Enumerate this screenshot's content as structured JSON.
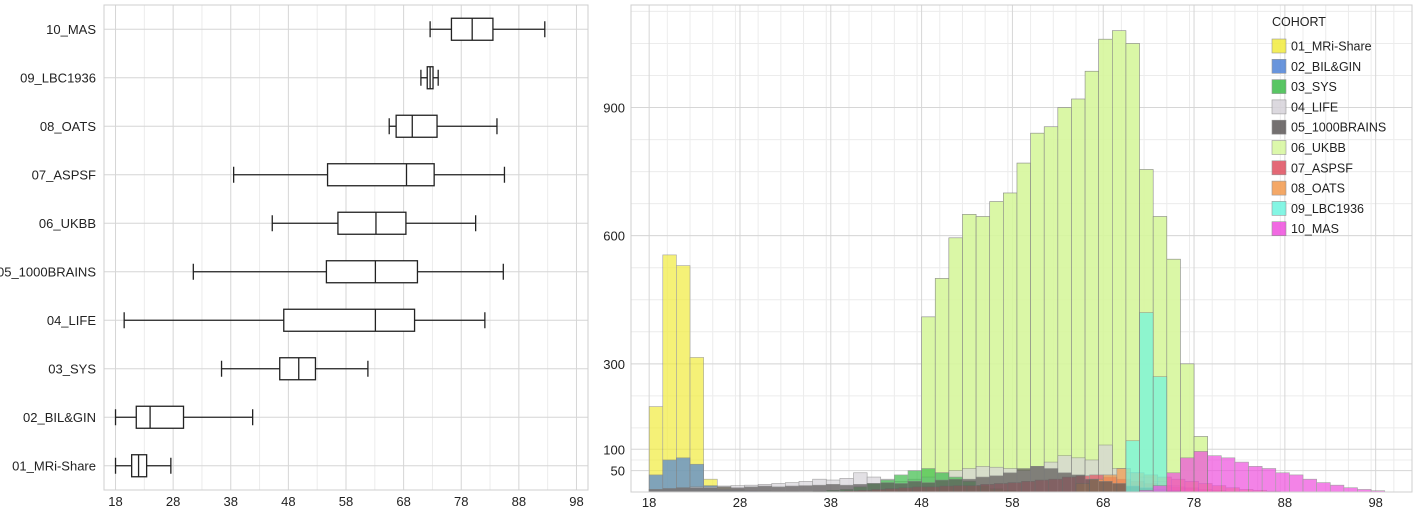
{
  "chart_data": [
    {
      "type": "boxplot",
      "orientation": "horizontal",
      "xlim": [
        16,
        100
      ],
      "xticks": [
        18,
        28,
        38,
        48,
        58,
        68,
        78,
        88,
        98
      ],
      "grid": true,
      "categories": [
        "10_MAS",
        "09_LBC1936",
        "08_OATS",
        "07_ASPSF",
        "06_UKBB",
        "05_1000BRAINS",
        "04_LIFE",
        "03_SYS",
        "02_BIL&GIN",
        "01_MRi-Share"
      ],
      "boxes": [
        {
          "name": "10_MAS",
          "min": 72.6,
          "q1": 76.3,
          "median": 79.9,
          "q3": 83.5,
          "max": 92.5
        },
        {
          "name": "09_LBC1936",
          "min": 71.0,
          "q1": 72.1,
          "median": 72.6,
          "q3": 73.1,
          "max": 74.0
        },
        {
          "name": "08_OATS",
          "min": 65.5,
          "q1": 66.7,
          "median": 69.5,
          "q3": 73.8,
          "max": 84.2
        },
        {
          "name": "07_ASPSF",
          "min": 38.5,
          "q1": 54.8,
          "median": 68.5,
          "q3": 73.3,
          "max": 85.5
        },
        {
          "name": "06_UKBB",
          "min": 45.2,
          "q1": 56.6,
          "median": 63.2,
          "q3": 68.4,
          "max": 80.5
        },
        {
          "name": "05_1000BRAINS",
          "min": 31.5,
          "q1": 54.6,
          "median": 63.1,
          "q3": 70.4,
          "max": 85.3
        },
        {
          "name": "04_LIFE",
          "min": 19.5,
          "q1": 47.2,
          "median": 63.1,
          "q3": 69.9,
          "max": 82.1
        },
        {
          "name": "03_SYS",
          "min": 36.4,
          "q1": 46.5,
          "median": 49.8,
          "q3": 52.7,
          "max": 61.8
        },
        {
          "name": "02_BIL&GIN",
          "min": 18.0,
          "q1": 21.6,
          "median": 24.0,
          "q3": 29.8,
          "max": 41.8
        },
        {
          "name": "01_MRi-Share",
          "min": 18.0,
          "q1": 20.8,
          "median": 22.0,
          "q3": 23.4,
          "max": 27.6
        }
      ]
    },
    {
      "type": "histogram",
      "stacked": false,
      "xlim": [
        16,
        102
      ],
      "xticks": [
        18,
        28,
        38,
        48,
        58,
        68,
        78,
        88,
        98
      ],
      "yticks": [
        50,
        100,
        300,
        600,
        900
      ],
      "ylim": [
        0,
        1140
      ],
      "bin_width": 1.5,
      "grid": true,
      "legend": {
        "title": "COHORT",
        "position": "top-right"
      },
      "series": [
        {
          "name": "01_MRi-Share",
          "color": "#f2ec3e",
          "start": 18,
          "values": [
            200,
            555,
            530,
            315,
            30,
            12,
            6,
            2
          ]
        },
        {
          "name": "02_BIL&GIN",
          "color": "#4f83d6",
          "start": 18,
          "values": [
            40,
            75,
            80,
            65,
            15,
            6,
            5,
            3,
            3,
            2,
            2,
            1,
            1,
            1,
            1,
            1
          ]
        },
        {
          "name": "03_SYS",
          "color": "#3dbd4a",
          "start": 36,
          "values": [
            2,
            4,
            6,
            12,
            20,
            28,
            40,
            50,
            55,
            45,
            35,
            25,
            15,
            8,
            4,
            2
          ]
        },
        {
          "name": "04_LIFE",
          "color": "#d7d3da",
          "start": 18,
          "values": [
            6,
            8,
            10,
            12,
            12,
            14,
            15,
            16,
            18,
            20,
            22,
            25,
            30,
            28,
            32,
            45,
            35,
            30,
            25,
            30,
            35,
            45,
            50,
            55,
            60,
            58,
            55,
            50,
            60,
            70,
            85,
            80,
            75,
            110,
            55,
            45,
            35,
            25,
            15,
            8,
            4
          ]
        },
        {
          "name": "05_1000BRAINS",
          "color": "#5c5858",
          "start": 18,
          "values": [
            6,
            8,
            10,
            10,
            10,
            12,
            10,
            12,
            14,
            12,
            14,
            15,
            16,
            18,
            16,
            18,
            20,
            22,
            20,
            25,
            22,
            28,
            30,
            30,
            35,
            38,
            45,
            55,
            60,
            55,
            45,
            40,
            30,
            25,
            20,
            14,
            10,
            6,
            3
          ]
        },
        {
          "name": "06_UKBB",
          "color": "#d7f79d",
          "start": 48,
          "values": [
            410,
            500,
            595,
            650,
            645,
            680,
            700,
            770,
            840,
            855,
            900,
            920,
            985,
            1060,
            1080,
            1050,
            755,
            645,
            545,
            300,
            130
          ]
        },
        {
          "name": "07_ASPSF",
          "color": "#e05060",
          "start": 38,
          "values": [
            2,
            3,
            4,
            6,
            8,
            10,
            12,
            12,
            14,
            15,
            15,
            18,
            20,
            22,
            25,
            28,
            30,
            35,
            38,
            40,
            35,
            30,
            25,
            20,
            15,
            12,
            10,
            6,
            4,
            2,
            1
          ]
        },
        {
          "name": "08_OATS",
          "color": "#f39a4d",
          "start": 65,
          "values": [
            20,
            30,
            40,
            55,
            45,
            40,
            35,
            30,
            25,
            20,
            15,
            10,
            6,
            4,
            2
          ]
        },
        {
          "name": "09_LBC1936",
          "color": "#6ff5e0",
          "start": 70.5,
          "values": [
            120,
            420,
            270
          ]
        },
        {
          "name": "10_MAS",
          "color": "#ef4fdd",
          "start": 72,
          "values": [
            4,
            15,
            45,
            80,
            95,
            85,
            80,
            70,
            60,
            55,
            45,
            40,
            30,
            22,
            16,
            10,
            6,
            3
          ]
        }
      ]
    }
  ]
}
